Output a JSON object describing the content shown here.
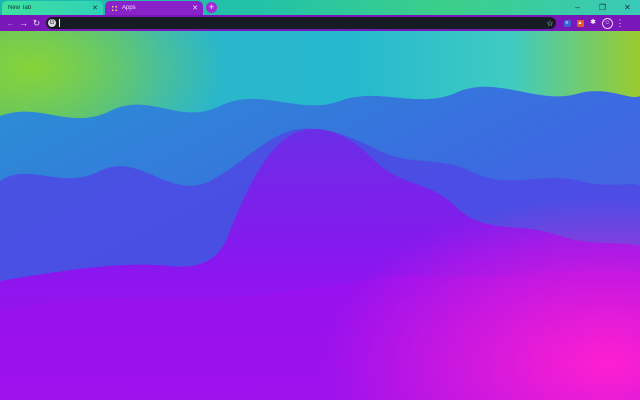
{
  "tabs": [
    {
      "label": "New Tab",
      "active": true,
      "favicon": "none"
    },
    {
      "label": "Apps",
      "active": false,
      "favicon": "apps-grid-icon"
    }
  ],
  "tab_close_glyph": "✕",
  "new_tab_glyph": "+",
  "window_controls": {
    "minimize": "–",
    "maximize": "❐",
    "close": "✕"
  },
  "toolbar": {
    "back": "←",
    "forward": "→",
    "reload": "↻",
    "omnibox_value": "",
    "bookmark_star": "☆",
    "extensions": [
      "extension-blue-icon",
      "extension-orange-icon",
      "extensions-puzzle-icon"
    ],
    "puzzle_glyph": "✱",
    "profile_glyph": "☺",
    "menu": "⋮"
  },
  "theme": {
    "tab_strip": "#22c2a8",
    "toolbar": "#7a17b8",
    "omnibox": "#151c24",
    "wallpaper_colors": [
      "#22b6c8",
      "#2e86dd",
      "#6a3ee8",
      "#8a1bf0",
      "#c018e6",
      "#9acb2e"
    ]
  }
}
